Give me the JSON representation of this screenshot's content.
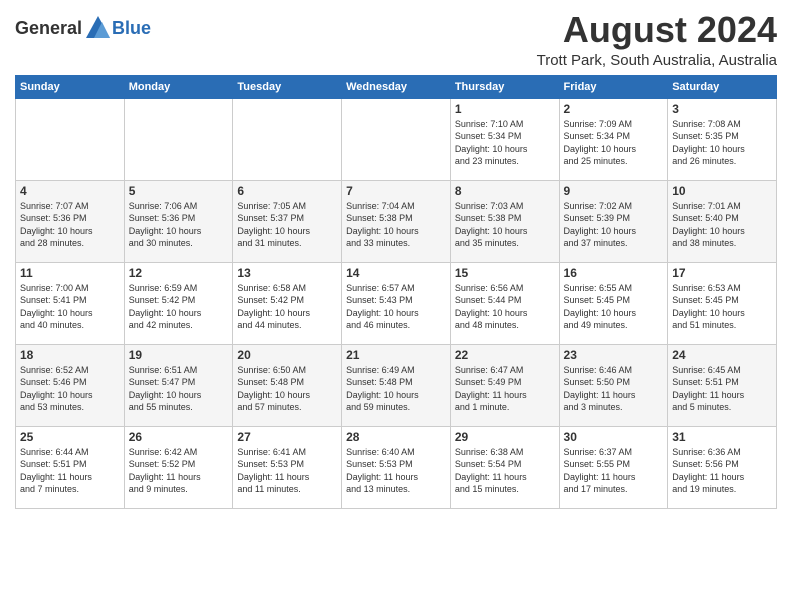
{
  "logo": {
    "general": "General",
    "blue": "Blue"
  },
  "title": "August 2024",
  "location": "Trott Park, South Australia, Australia",
  "days_of_week": [
    "Sunday",
    "Monday",
    "Tuesday",
    "Wednesday",
    "Thursday",
    "Friday",
    "Saturday"
  ],
  "weeks": [
    [
      {
        "day": "",
        "content": ""
      },
      {
        "day": "",
        "content": ""
      },
      {
        "day": "",
        "content": ""
      },
      {
        "day": "",
        "content": ""
      },
      {
        "day": "1",
        "content": "Sunrise: 7:10 AM\nSunset: 5:34 PM\nDaylight: 10 hours\nand 23 minutes."
      },
      {
        "day": "2",
        "content": "Sunrise: 7:09 AM\nSunset: 5:34 PM\nDaylight: 10 hours\nand 25 minutes."
      },
      {
        "day": "3",
        "content": "Sunrise: 7:08 AM\nSunset: 5:35 PM\nDaylight: 10 hours\nand 26 minutes."
      }
    ],
    [
      {
        "day": "4",
        "content": "Sunrise: 7:07 AM\nSunset: 5:36 PM\nDaylight: 10 hours\nand 28 minutes."
      },
      {
        "day": "5",
        "content": "Sunrise: 7:06 AM\nSunset: 5:36 PM\nDaylight: 10 hours\nand 30 minutes."
      },
      {
        "day": "6",
        "content": "Sunrise: 7:05 AM\nSunset: 5:37 PM\nDaylight: 10 hours\nand 31 minutes."
      },
      {
        "day": "7",
        "content": "Sunrise: 7:04 AM\nSunset: 5:38 PM\nDaylight: 10 hours\nand 33 minutes."
      },
      {
        "day": "8",
        "content": "Sunrise: 7:03 AM\nSunset: 5:38 PM\nDaylight: 10 hours\nand 35 minutes."
      },
      {
        "day": "9",
        "content": "Sunrise: 7:02 AM\nSunset: 5:39 PM\nDaylight: 10 hours\nand 37 minutes."
      },
      {
        "day": "10",
        "content": "Sunrise: 7:01 AM\nSunset: 5:40 PM\nDaylight: 10 hours\nand 38 minutes."
      }
    ],
    [
      {
        "day": "11",
        "content": "Sunrise: 7:00 AM\nSunset: 5:41 PM\nDaylight: 10 hours\nand 40 minutes."
      },
      {
        "day": "12",
        "content": "Sunrise: 6:59 AM\nSunset: 5:42 PM\nDaylight: 10 hours\nand 42 minutes."
      },
      {
        "day": "13",
        "content": "Sunrise: 6:58 AM\nSunset: 5:42 PM\nDaylight: 10 hours\nand 44 minutes."
      },
      {
        "day": "14",
        "content": "Sunrise: 6:57 AM\nSunset: 5:43 PM\nDaylight: 10 hours\nand 46 minutes."
      },
      {
        "day": "15",
        "content": "Sunrise: 6:56 AM\nSunset: 5:44 PM\nDaylight: 10 hours\nand 48 minutes."
      },
      {
        "day": "16",
        "content": "Sunrise: 6:55 AM\nSunset: 5:45 PM\nDaylight: 10 hours\nand 49 minutes."
      },
      {
        "day": "17",
        "content": "Sunrise: 6:53 AM\nSunset: 5:45 PM\nDaylight: 10 hours\nand 51 minutes."
      }
    ],
    [
      {
        "day": "18",
        "content": "Sunrise: 6:52 AM\nSunset: 5:46 PM\nDaylight: 10 hours\nand 53 minutes."
      },
      {
        "day": "19",
        "content": "Sunrise: 6:51 AM\nSunset: 5:47 PM\nDaylight: 10 hours\nand 55 minutes."
      },
      {
        "day": "20",
        "content": "Sunrise: 6:50 AM\nSunset: 5:48 PM\nDaylight: 10 hours\nand 57 minutes."
      },
      {
        "day": "21",
        "content": "Sunrise: 6:49 AM\nSunset: 5:48 PM\nDaylight: 10 hours\nand 59 minutes."
      },
      {
        "day": "22",
        "content": "Sunrise: 6:47 AM\nSunset: 5:49 PM\nDaylight: 11 hours\nand 1 minute."
      },
      {
        "day": "23",
        "content": "Sunrise: 6:46 AM\nSunset: 5:50 PM\nDaylight: 11 hours\nand 3 minutes."
      },
      {
        "day": "24",
        "content": "Sunrise: 6:45 AM\nSunset: 5:51 PM\nDaylight: 11 hours\nand 5 minutes."
      }
    ],
    [
      {
        "day": "25",
        "content": "Sunrise: 6:44 AM\nSunset: 5:51 PM\nDaylight: 11 hours\nand 7 minutes."
      },
      {
        "day": "26",
        "content": "Sunrise: 6:42 AM\nSunset: 5:52 PM\nDaylight: 11 hours\nand 9 minutes."
      },
      {
        "day": "27",
        "content": "Sunrise: 6:41 AM\nSunset: 5:53 PM\nDaylight: 11 hours\nand 11 minutes."
      },
      {
        "day": "28",
        "content": "Sunrise: 6:40 AM\nSunset: 5:53 PM\nDaylight: 11 hours\nand 13 minutes."
      },
      {
        "day": "29",
        "content": "Sunrise: 6:38 AM\nSunset: 5:54 PM\nDaylight: 11 hours\nand 15 minutes."
      },
      {
        "day": "30",
        "content": "Sunrise: 6:37 AM\nSunset: 5:55 PM\nDaylight: 11 hours\nand 17 minutes."
      },
      {
        "day": "31",
        "content": "Sunrise: 6:36 AM\nSunset: 5:56 PM\nDaylight: 11 hours\nand 19 minutes."
      }
    ]
  ]
}
